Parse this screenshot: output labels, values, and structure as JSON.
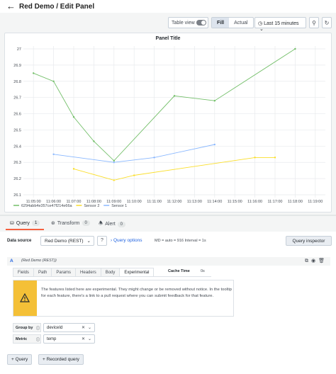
{
  "header": {
    "back_icon": "arrow-left-icon",
    "title": "Red Demo / Edit Panel"
  },
  "toolbar": {
    "table_view": "Table view",
    "fill": "Fill",
    "actual": "Actual",
    "time_range": "Last 15 minutes",
    "zoom_icon": "zoom-out-icon",
    "refresh_icon": "refresh-icon"
  },
  "panel": {
    "title": "Panel Title"
  },
  "chart_data": {
    "type": "line",
    "title": "Panel Title",
    "x": [
      "11:05:00",
      "11:06:00",
      "11:07:00",
      "11:08:00",
      "11:09:00",
      "11:10:00",
      "11:11:00",
      "11:12:00",
      "11:13:00",
      "11:14:00",
      "11:15:00",
      "11:16:00",
      "11:17:00",
      "11:18:00",
      "11:19:00"
    ],
    "y_ticks": [
      "26.1",
      "26.2",
      "26.3",
      "26.4",
      "26.5",
      "26.6",
      "26.7",
      "26.8",
      "26.9",
      "27"
    ],
    "ylim": [
      26.1,
      27.0
    ],
    "grid": true,
    "legend_placement": "bottom-left",
    "series": [
      {
        "name": "6294abb4e357ce47f214e66a",
        "color": "#73bf69",
        "points": [
          [
            0,
            26.85
          ],
          [
            1,
            26.8
          ],
          [
            2,
            26.58
          ],
          [
            3,
            26.43
          ],
          [
            4,
            26.31
          ],
          [
            7,
            26.71
          ],
          [
            9,
            26.68
          ],
          [
            13,
            27.0
          ]
        ]
      },
      {
        "name": "Sensor 2",
        "color": "#fade2a",
        "points": [
          [
            2,
            26.26
          ],
          [
            4,
            26.19
          ],
          [
            5,
            26.22
          ],
          [
            11,
            26.33
          ],
          [
            12,
            26.33
          ]
        ]
      },
      {
        "name": "Sensor 1",
        "color": "#8ab8ff",
        "points": [
          [
            1,
            26.35
          ],
          [
            4,
            26.3
          ],
          [
            6,
            26.33
          ],
          [
            9,
            26.41
          ]
        ]
      }
    ]
  },
  "tabs": [
    {
      "label": "Query",
      "count": "1",
      "icon": "database-icon"
    },
    {
      "label": "Transform",
      "count": "0",
      "icon": "transform-icon"
    },
    {
      "label": "Alert",
      "count": "0",
      "icon": "bell-icon"
    }
  ],
  "query": {
    "data_source_label": "Data source",
    "data_source": "Red Demo (REST)",
    "query_options": "Query options",
    "meta": "MD = auto = 916     Interval = 1s",
    "inspector": "Query inspector",
    "row_letter": "A",
    "row_ds": "(Red Demo (REST))",
    "subtabs": [
      "Fields",
      "Path",
      "Params",
      "Headers",
      "Body",
      "Experimental"
    ],
    "cache_label": "Cache Time",
    "cache_value": "0s",
    "warning": "The features listed here are experimental. They might change or be removed without notice. In the tooltip for each feature, there's a link to a pull request where you can submit feedback for that feature.",
    "group_by_label": "Group by",
    "group_by_value": "deviceId",
    "metric_label": "Metric",
    "metric_value": "temp",
    "add_query": "Query",
    "recorded_query": "Recorded query"
  }
}
